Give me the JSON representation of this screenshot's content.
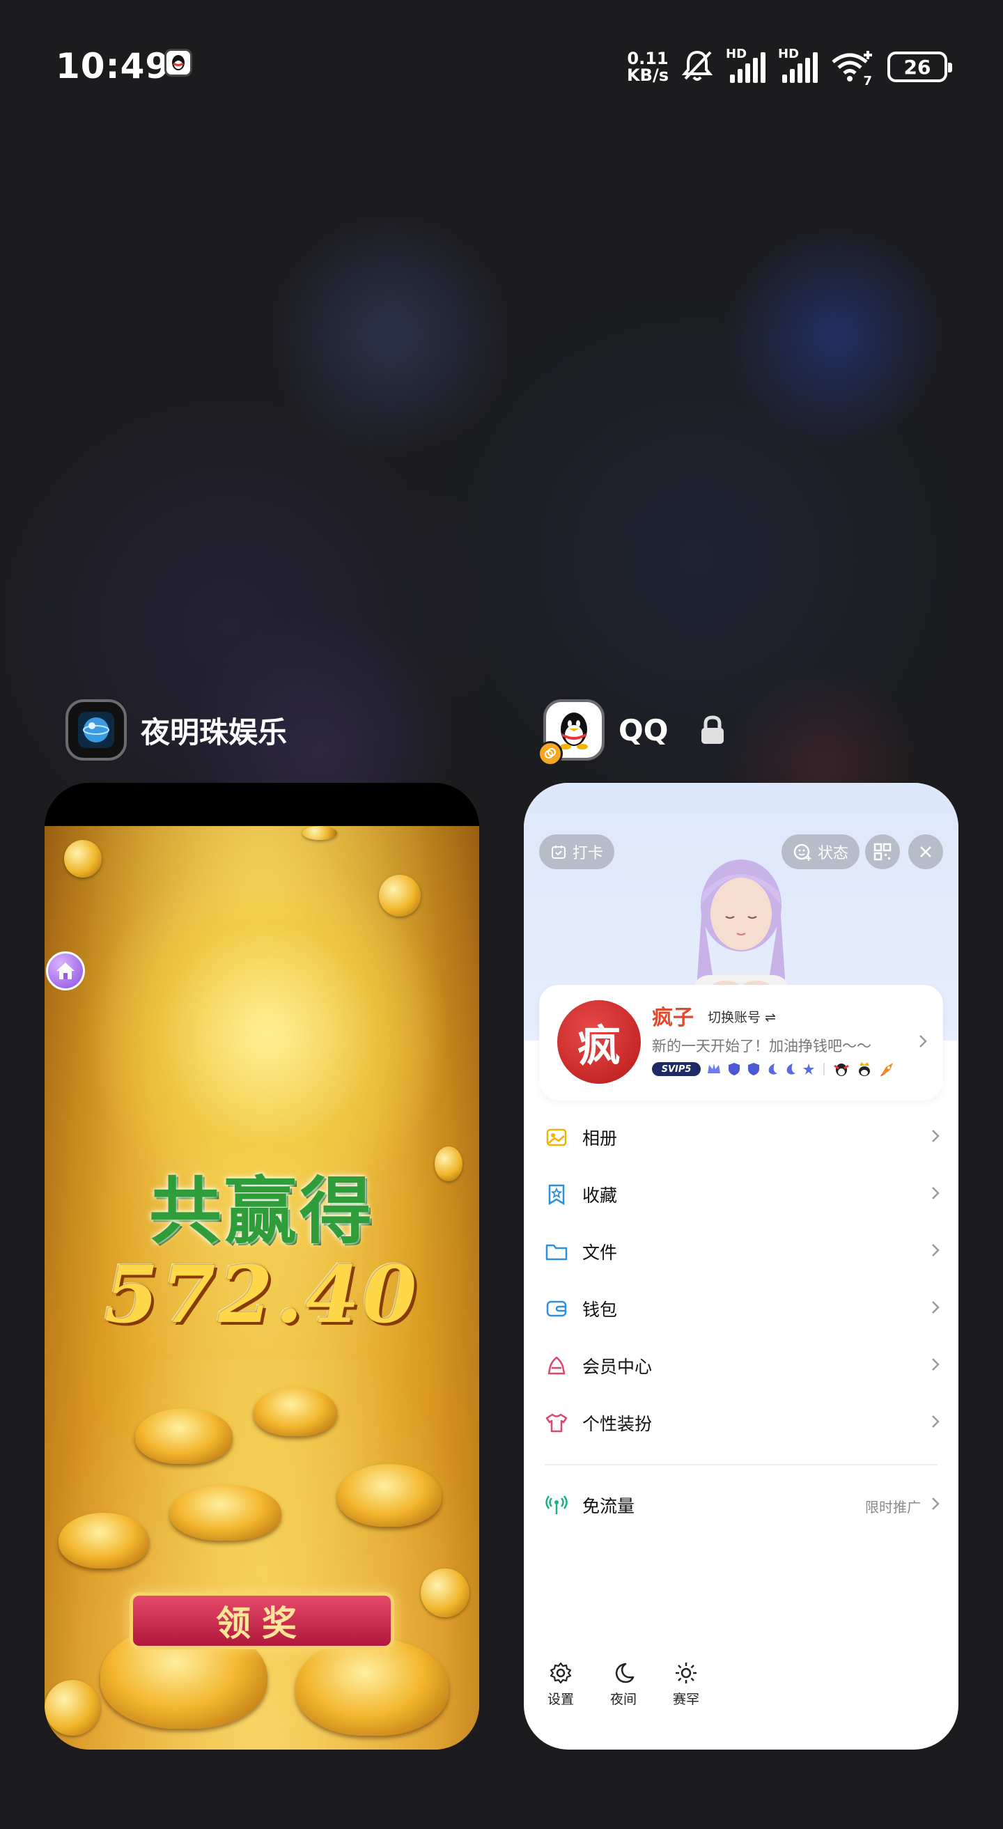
{
  "status_bar": {
    "time": "10:49",
    "net_speed_value": "0.11",
    "net_speed_unit": "KB/s",
    "signal_1_label": "HD",
    "signal_2_label": "HD",
    "wifi_badge": "7",
    "battery": "26"
  },
  "apps": [
    {
      "name": "夜明珠娱乐",
      "icon": "pearl-globe-icon",
      "screen": {
        "win_title": "共赢得",
        "win_amount": "572.40",
        "claim_button": "领奖"
      }
    },
    {
      "name": "QQ",
      "icon": "qq-penguin-icon",
      "locked": true,
      "screen": {
        "checkin_label": "打卡",
        "status_label": "状态",
        "profile": {
          "avatar_char": "疯",
          "nickname": "疯子",
          "switch_account": "切换账号 ⇌",
          "signature": "新的一天开始了！加油挣钱吧～～",
          "svip_badge": "SVIP5"
        },
        "menu_items": [
          {
            "label": "相册",
            "icon": "album-icon"
          },
          {
            "label": "收藏",
            "icon": "favorites-icon"
          },
          {
            "label": "文件",
            "icon": "folder-icon"
          },
          {
            "label": "钱包",
            "icon": "wallet-icon"
          },
          {
            "label": "会员中心",
            "icon": "vip-center-icon"
          },
          {
            "label": "个性装扮",
            "icon": "tshirt-icon"
          }
        ],
        "free_data": {
          "label": "免流量",
          "extra": "限时推广",
          "icon": "free-data-icon"
        },
        "bottom_bar": [
          {
            "label": "设置",
            "icon": "settings-icon"
          },
          {
            "label": "夜间",
            "icon": "moon-icon"
          },
          {
            "label": "赛罕",
            "icon": "sun-icon"
          }
        ]
      }
    }
  ],
  "colors": {
    "background": "#1c1c1e",
    "qq_nickname": "#e24a2d",
    "win_title": "#2f9e3a",
    "win_amount": "#ffd84a"
  }
}
